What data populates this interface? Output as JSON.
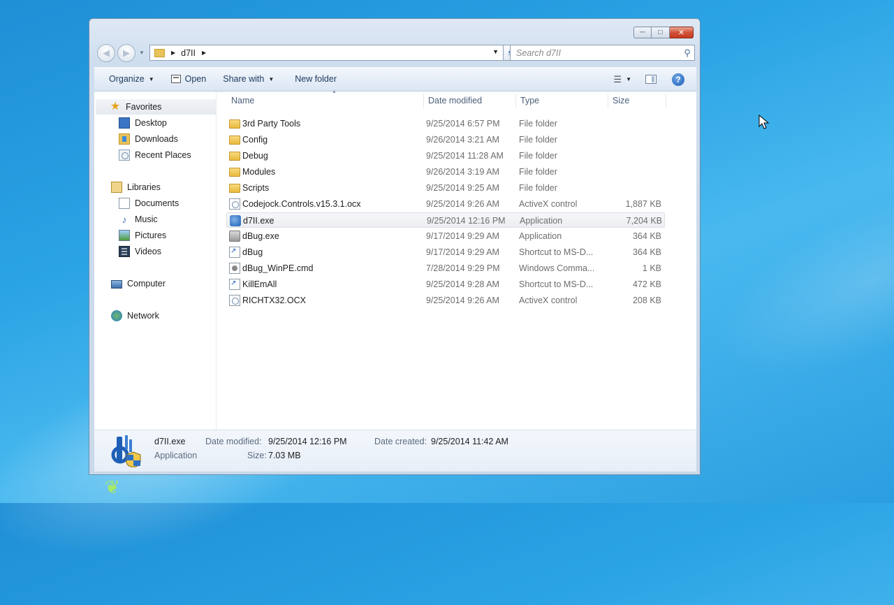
{
  "window": {
    "caption_buttons": {
      "minimize": "─",
      "maximize": "□",
      "close": "✕"
    },
    "address": {
      "path": "d7II"
    },
    "search": {
      "placeholder": "Search d7II"
    }
  },
  "toolbar": {
    "organize": "Organize",
    "open": "Open",
    "share_with": "Share with",
    "new_folder": "New folder"
  },
  "nav": {
    "favorites": {
      "label": "Favorites",
      "items": [
        "Desktop",
        "Downloads",
        "Recent Places"
      ]
    },
    "libraries": {
      "label": "Libraries",
      "items": [
        "Documents",
        "Music",
        "Pictures",
        "Videos"
      ]
    },
    "computer": "Computer",
    "network": "Network"
  },
  "columns": {
    "name": "Name",
    "date": "Date modified",
    "type": "Type",
    "size": "Size"
  },
  "files": [
    {
      "name": "3rd Party Tools",
      "date": "9/25/2014 6:57 PM",
      "type": "File folder",
      "size": "",
      "icon": "folder-icon"
    },
    {
      "name": "Config",
      "date": "9/26/2014 3:21 AM",
      "type": "File folder",
      "size": "",
      "icon": "folder-icon"
    },
    {
      "name": "Debug",
      "date": "9/25/2014 11:28 AM",
      "type": "File folder",
      "size": "",
      "icon": "folder-icon"
    },
    {
      "name": "Modules",
      "date": "9/26/2014 3:19 AM",
      "type": "File folder",
      "size": "",
      "icon": "folder-icon"
    },
    {
      "name": "Scripts",
      "date": "9/25/2014 9:25 AM",
      "type": "File folder",
      "size": "",
      "icon": "folder-icon"
    },
    {
      "name": "Codejock.Controls.v15.3.1.ocx",
      "date": "9/25/2014 9:26 AM",
      "type": "ActiveX control",
      "size": "1,887 KB",
      "icon": "activex-file-icon"
    },
    {
      "name": "d7II.exe",
      "date": "9/25/2014 12:16 PM",
      "type": "Application",
      "size": "7,204 KB",
      "icon": "d7ii-app-icon"
    },
    {
      "name": "dBug.exe",
      "date": "9/17/2014 9:29 AM",
      "type": "Application",
      "size": "364 KB",
      "icon": "dbug-app-icon"
    },
    {
      "name": "dBug",
      "date": "9/17/2014 9:29 AM",
      "type": "Shortcut to MS-D...",
      "size": "364 KB",
      "icon": "shortcut-icon"
    },
    {
      "name": "dBug_WinPE.cmd",
      "date": "7/28/2014 9:29 PM",
      "type": "Windows Comma...",
      "size": "1 KB",
      "icon": "cmd-file-icon"
    },
    {
      "name": "KillEmAll",
      "date": "9/25/2014 9:28 AM",
      "type": "Shortcut to MS-D...",
      "size": "472 KB",
      "icon": "shortcut-icon"
    },
    {
      "name": "RICHTX32.OCX",
      "date": "9/25/2014 9:26 AM",
      "type": "ActiveX control",
      "size": "208 KB",
      "icon": "activex-file-icon"
    }
  ],
  "details": {
    "name": "d7II.exe",
    "type": "Application",
    "date_modified_label": "Date modified:",
    "date_modified": "9/25/2014 12:16 PM",
    "date_created_label": "Date created:",
    "date_created": "9/25/2014 11:42 AM",
    "size_label": "Size:",
    "size": "7.03 MB"
  }
}
